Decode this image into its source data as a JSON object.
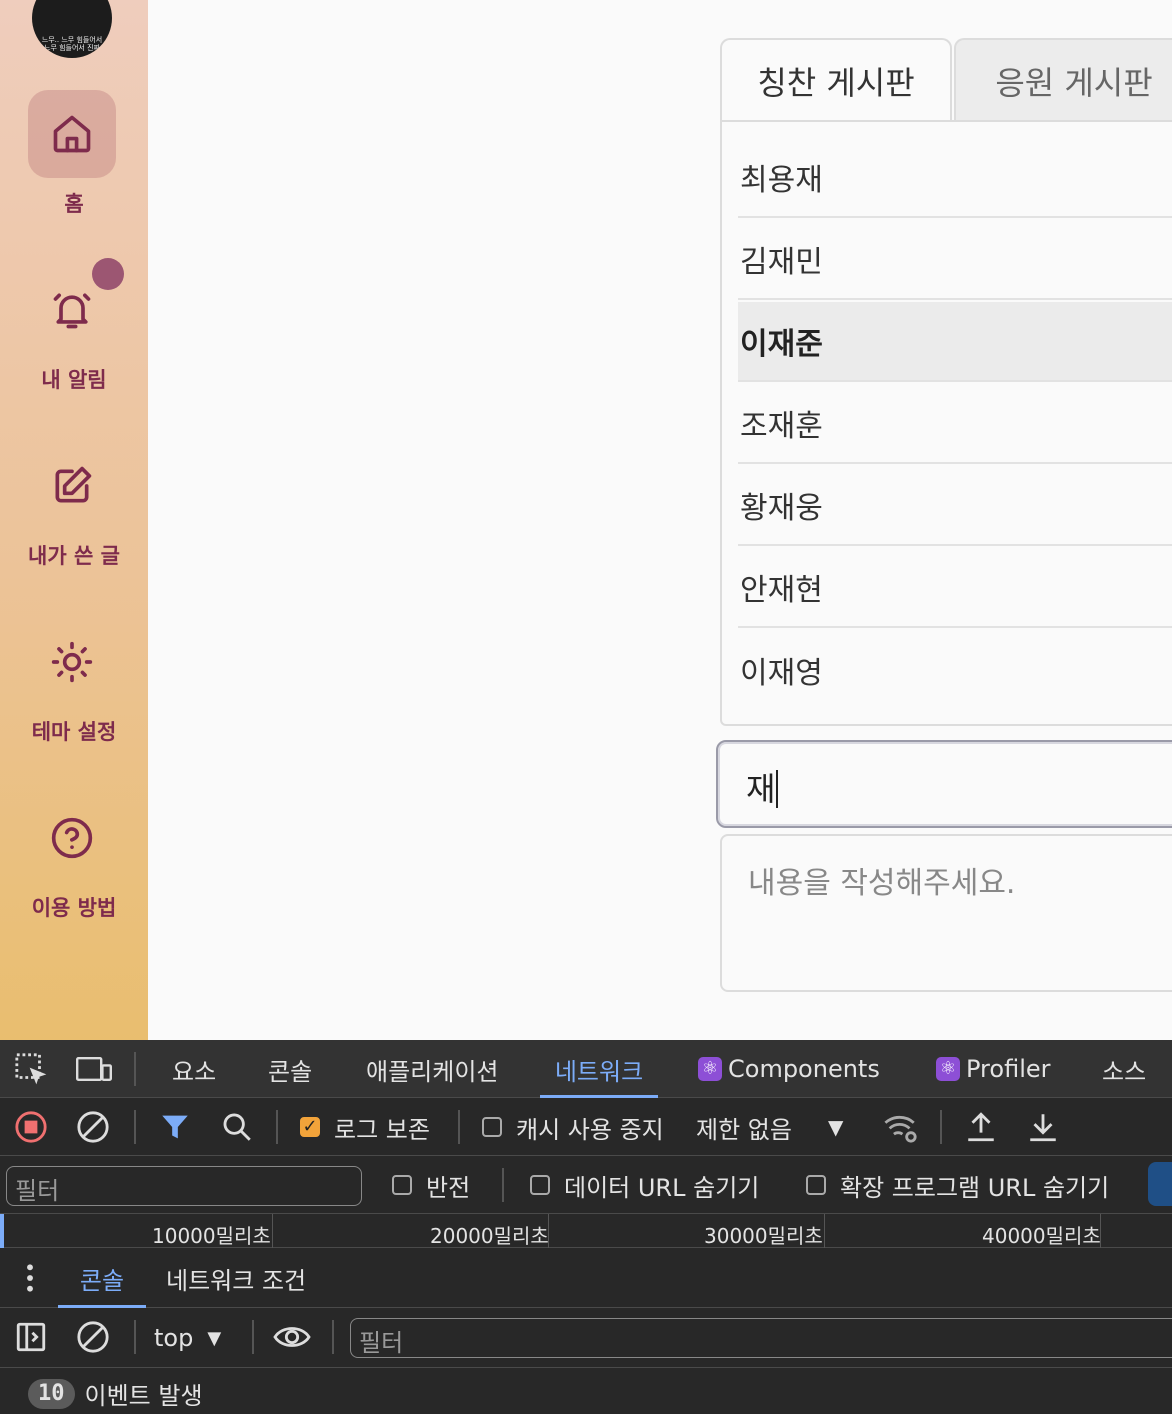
{
  "sidebar": {
    "avatar_caption": [
      "느무.. 느무 힘들어서",
      "느무 힘들어서 진짜"
    ],
    "items": [
      {
        "label": "홈",
        "icon": "home-icon",
        "active": true
      },
      {
        "label": "내 알림",
        "icon": "bell-icon",
        "active": false
      },
      {
        "label": "내가 쓴 글",
        "icon": "edit-icon",
        "active": false
      },
      {
        "label": "테마 설정",
        "icon": "sun-icon",
        "active": false
      },
      {
        "label": "이용 방법",
        "icon": "question-icon",
        "active": false
      }
    ],
    "colors": {
      "accent": "#7e2b4c",
      "active_bg": "#e0b4ad",
      "notification_dot": "#9c5672"
    }
  },
  "board": {
    "tabs": [
      {
        "label": "칭찬 게시판",
        "active": true
      },
      {
        "label": "응원 게시판",
        "active": false
      }
    ],
    "suggestions": [
      {
        "name": "최용재"
      },
      {
        "name": "김재민"
      },
      {
        "name": "이재준",
        "selected": true
      },
      {
        "name": "조재훈"
      },
      {
        "name": "황재웅"
      },
      {
        "name": "안재현"
      },
      {
        "name": "이재영"
      }
    ],
    "name_input_value": "재",
    "content_placeholder": "내용을 작성해주세요."
  },
  "devtools": {
    "tabs": [
      {
        "label": "요소"
      },
      {
        "label": "콘솔"
      },
      {
        "label": "애플리케이션"
      },
      {
        "label": "네트워크",
        "active": true
      },
      {
        "label": "Components",
        "icon": "react-icon"
      },
      {
        "label": "Profiler",
        "icon": "react-icon"
      },
      {
        "label": "소스"
      }
    ],
    "toolbar": {
      "preserve_log": {
        "label": "로그 보존",
        "checked": true
      },
      "disable_cache": {
        "label": "캐시 사용 중지",
        "checked": false
      },
      "throttling": "제한 없음"
    },
    "filter": {
      "placeholder": "필터",
      "invert": {
        "label": "반전",
        "checked": false
      },
      "hide_data_urls": {
        "label": "데이터 URL 숨기기",
        "checked": false
      },
      "hide_extension_urls": {
        "label": "확장 프로그램 URL 숨기기",
        "checked": false
      }
    },
    "timeline_ticks": [
      "10000밀리초",
      "20000밀리초",
      "30000밀리초",
      "40000밀리초"
    ],
    "drawer_tabs": [
      {
        "label": "콘솔",
        "active": true
      },
      {
        "label": "네트워크 조건"
      }
    ],
    "console": {
      "context": "top",
      "filter_placeholder": "필터",
      "event_count": "10",
      "event_label": "이벤트 발생"
    }
  }
}
